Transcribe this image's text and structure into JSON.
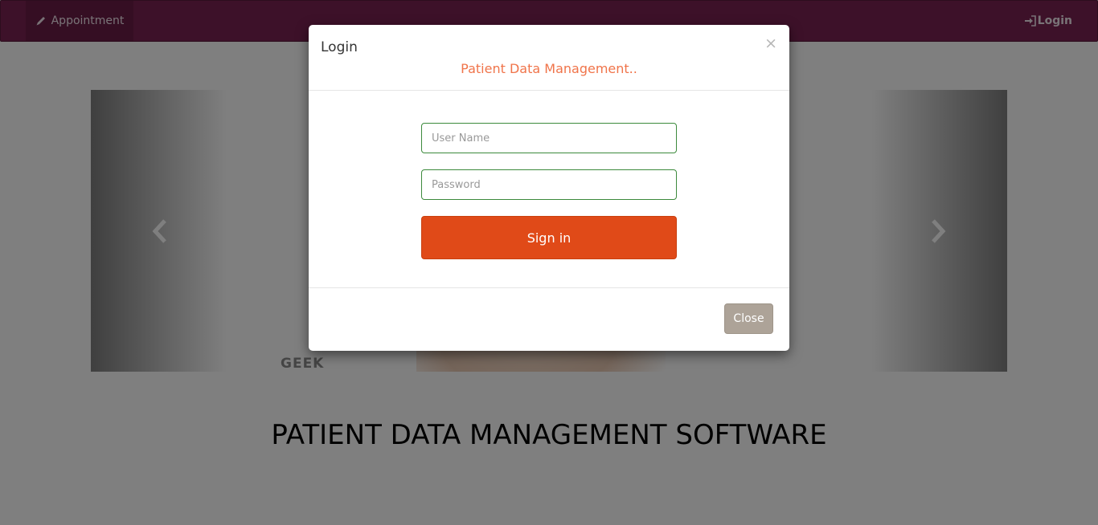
{
  "navbar": {
    "appointment_label": "Appointment",
    "appointment_icon": "pencil-icon",
    "login_label": "Login",
    "login_icon": "log-in-icon",
    "color": "#7a2352"
  },
  "carousel": {
    "watermark_text": "GEEK",
    "prev_icon": "chevron-left-icon",
    "next_icon": "chevron-right-icon"
  },
  "page": {
    "heading": "PATIENT DATA MANAGEMENT SOFTWARE"
  },
  "modal": {
    "title": "Login",
    "subtitle": "Patient Data Management..",
    "close_x": "×",
    "username_placeholder": "User Name",
    "username_value": "",
    "password_placeholder": "Password",
    "password_value": "",
    "signin_label": "Sign in",
    "close_label": "Close",
    "accent_color": "#e04a18",
    "subtitle_color": "#f0744a"
  }
}
